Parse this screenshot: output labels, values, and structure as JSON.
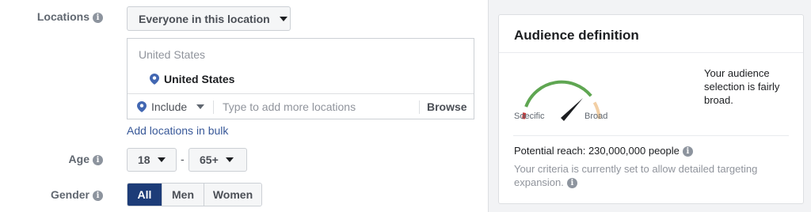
{
  "locations": {
    "label": "Locations",
    "dropdown_value": "Everyone in this location",
    "country_header": "United States",
    "selected": "United States",
    "include_label": "Include",
    "placeholder": "Type to add more locations",
    "browse_label": "Browse",
    "bulk_link": "Add locations in bulk"
  },
  "age": {
    "label": "Age",
    "min": "18",
    "separator": "-",
    "max": "65+"
  },
  "gender": {
    "label": "Gender",
    "options": [
      "All",
      "Men",
      "Women"
    ],
    "selected": "All"
  },
  "audience": {
    "title": "Audience definition",
    "gauge_low_label": "Soecific",
    "gauge_high_label": "Broad",
    "description": "Your audience selection is fairly broad.",
    "potential_reach": "Potential reach: 230,000,000 people",
    "criteria_note": "Your criteria is currently set to allow detailed targeting expansion."
  },
  "colors": {
    "link": "#385898",
    "active_segment": "#1d3c78",
    "pin": "#4267b2",
    "gauge_red": "#c4393b",
    "gauge_green": "#5fa652",
    "gauge_peach": "#f2cfa5",
    "gauge_needle": "#1c1e21"
  },
  "icons": {
    "info": "info-icon",
    "pin": "location-pin-icon",
    "caret": "caret-down-icon"
  }
}
